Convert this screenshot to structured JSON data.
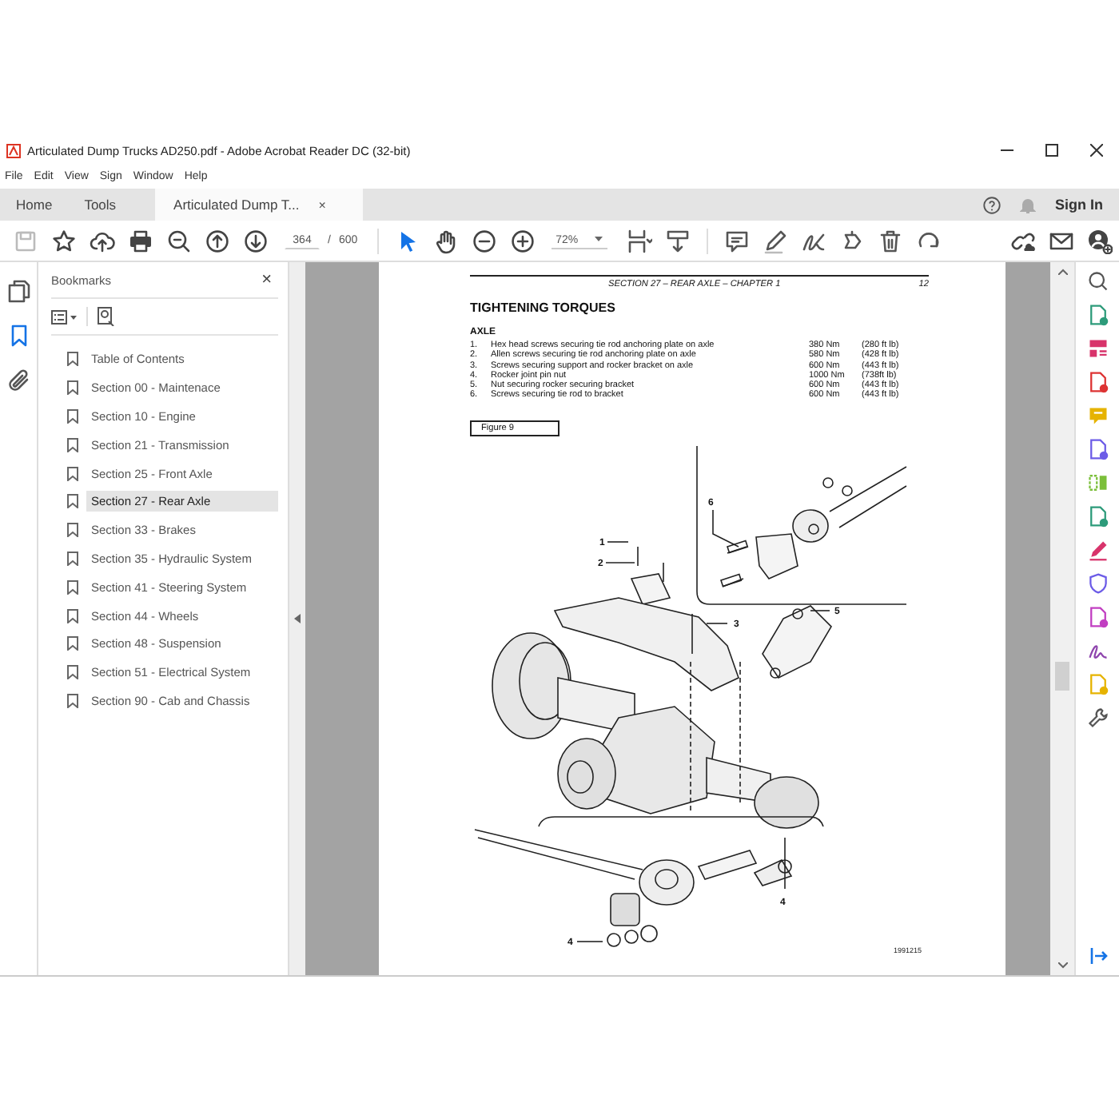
{
  "window": {
    "title": "Articulated Dump Trucks AD250.pdf - Adobe Acrobat Reader DC (32-bit)"
  },
  "menu": [
    "File",
    "Edit",
    "View",
    "Sign",
    "Window",
    "Help"
  ],
  "tabs": [
    {
      "label": "Home",
      "selected": false,
      "kind": "nav"
    },
    {
      "label": "Tools",
      "selected": false,
      "kind": "nav"
    },
    {
      "label": "Articulated Dump T...",
      "selected": true,
      "kind": "document",
      "close": "×"
    }
  ],
  "header": {
    "sign_in": "Sign In"
  },
  "toolbar": {
    "file_tools": [
      {
        "kind": "save",
        "disabled": true
      },
      {
        "kind": "star",
        "disabled": false
      },
      {
        "kind": "upload",
        "disabled": false
      },
      {
        "kind": "print",
        "disabled": false
      },
      {
        "kind": "find",
        "disabled": false
      },
      {
        "kind": "page-up",
        "disabled": false
      },
      {
        "kind": "page-down",
        "disabled": false
      }
    ],
    "page_current": "364",
    "page_separator": "/",
    "page_total": "600",
    "view_tools": [
      {
        "kind": "pointer",
        "selected": true
      },
      {
        "kind": "hand",
        "selected": false
      },
      {
        "kind": "zoom-out",
        "selected": false
      },
      {
        "kind": "zoom-in",
        "selected": false
      }
    ],
    "zoom": "72%",
    "edit_tools": [
      {
        "kind": "fit"
      },
      {
        "kind": "scroll"
      },
      {
        "kind": "comment"
      },
      {
        "kind": "pen"
      },
      {
        "kind": "sign"
      },
      {
        "kind": "stamp"
      },
      {
        "kind": "delete"
      },
      {
        "kind": "rotate"
      }
    ],
    "share_tools": [
      {
        "kind": "link"
      },
      {
        "kind": "mail"
      },
      {
        "kind": "user"
      }
    ]
  },
  "rail": [
    {
      "kind": "pages",
      "selected": false
    },
    {
      "kind": "bookmark",
      "selected": true
    },
    {
      "kind": "attachment",
      "selected": false
    }
  ],
  "bookmarks": {
    "title": "Bookmarks",
    "close": "×",
    "items": [
      {
        "label": "Table of Contents",
        "selected": false
      },
      {
        "label": "Section 00 - Maintenace",
        "selected": false
      },
      {
        "label": "Section 10 - Engine",
        "selected": false
      },
      {
        "label": "Section 21 - Transmission",
        "selected": false
      },
      {
        "label": "Section 25 - Front Axle",
        "selected": false
      },
      {
        "label": "Section 27 - Rear Axle",
        "selected": true
      },
      {
        "label": "Section 33 - Brakes",
        "selected": false
      },
      {
        "label": "Section 35 - Hydraulic System",
        "selected": false
      },
      {
        "label": "Section 41 - Steering System",
        "selected": false
      },
      {
        "label": "Section 44 - Wheels",
        "selected": false
      },
      {
        "label": "Section 48 - Suspension",
        "selected": false
      },
      {
        "label": "Section 51 - Electrical System",
        "selected": false
      },
      {
        "label": "Section 90 - Cab and Chassis",
        "selected": false
      }
    ]
  },
  "document": {
    "running_header": "SECTION 27 – REAR AXLE – CHAPTER 1",
    "page_number": "12",
    "title": "TIGHTENING TORQUES",
    "subtitle": "AXLE",
    "rows": [
      {
        "number": "1.",
        "description": "Hex head screws securing tie rod anchoring plate on axle",
        "torque_nm": "380 Nm",
        "torque_ftlb": "(280 ft lb)"
      },
      {
        "number": "2.",
        "description": "Allen screws securing tie rod anchoring plate on axle",
        "torque_nm": "580 Nm",
        "torque_ftlb": "(428 ft lb)"
      },
      {
        "number": "3.",
        "description": "Screws securing support and rocker bracket on axle",
        "torque_nm": "600 Nm",
        "torque_ftlb": "(443 ft lb)"
      },
      {
        "number": "4.",
        "description": "Rocker joint pin nut",
        "torque_nm": "1000 Nm",
        "torque_ftlb": "(738ft lb)"
      },
      {
        "number": "5.",
        "description": "Nut securing rocker securing bracket",
        "torque_nm": "600 Nm",
        "torque_ftlb": "(443 ft lb)"
      },
      {
        "number": "6.",
        "description": "Screws securing tie rod to bracket",
        "torque_nm": "600 Nm",
        "torque_ftlb": "(443 ft lb)"
      }
    ],
    "figure_label": "Figure 9",
    "callouts": [
      "6",
      "1",
      "2",
      "3",
      "5",
      "4",
      "4"
    ],
    "figure_id": "1991215"
  }
}
